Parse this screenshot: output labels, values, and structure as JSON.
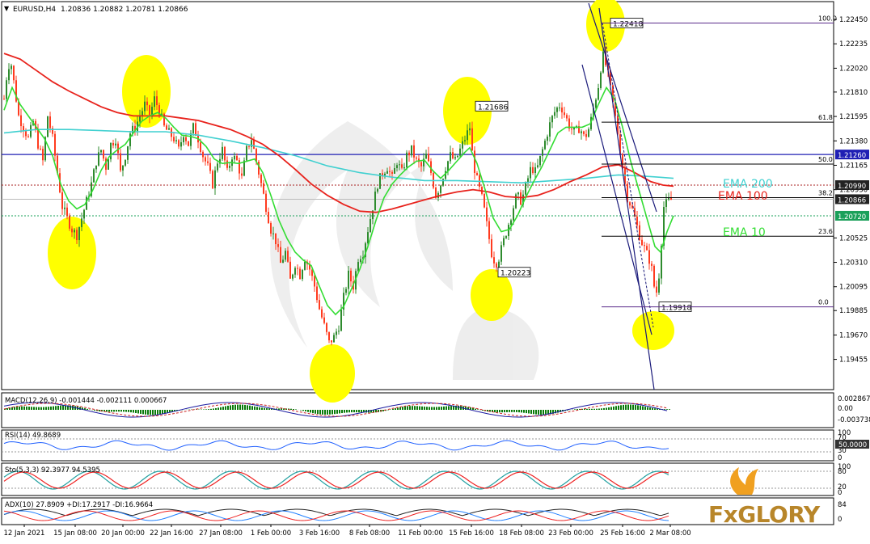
{
  "header": {
    "symbol_label": "EURUSD,H4",
    "ohlc_label": "1.20836 1.20882 1.20781 1.20866"
  },
  "indicator_labels": {
    "ema200": "EMA 200",
    "ema100": "EMA 100",
    "ema10": "EMA 10"
  },
  "colors": {
    "bull": "#2e8b2e",
    "bear": "#ff3b1f",
    "ema10": "#33dd33",
    "ema100": "#e8221c",
    "ema200": "#40d0d0",
    "highlight": "#ffff00",
    "hline_blue": "#1f1fb4",
    "trend": "#1a1a7a",
    "price_tag_bg": "#1f1fb4",
    "price_tag_green": "#1aa05a",
    "price_tag_red": "#cc1111"
  },
  "chart_data": [
    {
      "type": "candlestick",
      "title": "EURUSD,H4",
      "ylim": [
        1.19445,
        1.2245
      ],
      "y_ticks": [
        "1.22450",
        "1.22235",
        "1.22020",
        "1.21810",
        "1.21595",
        "1.21380",
        "1.21165",
        "1.20950",
        "1.20525",
        "1.20310",
        "1.20095",
        "1.19885",
        "1.19670",
        "1.19455"
      ],
      "x_labels": [
        "12 Jan 2021",
        "15 Jan 08:00",
        "20 Jan 00:00",
        "22 Jan 16:00",
        "27 Jan 08:00",
        "1 Feb 00:00",
        "3 Feb 16:00",
        "8 Feb 08:00",
        "11 Feb 00:00",
        "15 Feb 16:00",
        "18 Feb 08:00",
        "23 Feb 00:00",
        "25 Feb 16:00",
        "2 Mar 08:00"
      ],
      "close_path": [
        [
          0,
          1.2175
        ],
        [
          4,
          1.22
        ],
        [
          8,
          1.221
        ],
        [
          12,
          1.219
        ],
        [
          18,
          1.216
        ],
        [
          24,
          1.215
        ],
        [
          30,
          1.214
        ],
        [
          36,
          1.2155
        ],
        [
          42,
          1.2135
        ],
        [
          48,
          1.212
        ],
        [
          54,
          1.216
        ],
        [
          60,
          1.214
        ],
        [
          66,
          1.211
        ],
        [
          72,
          1.208
        ],
        [
          78,
          1.207
        ],
        [
          84,
          1.206
        ],
        [
          90,
          1.2055
        ],
        [
          96,
          1.207
        ],
        [
          102,
          1.2085
        ],
        [
          108,
          1.21
        ],
        [
          114,
          1.212
        ],
        [
          120,
          1.213
        ],
        [
          126,
          1.2115
        ],
        [
          132,
          1.2135
        ],
        [
          138,
          1.214
        ],
        [
          144,
          1.211
        ],
        [
          150,
          1.2125
        ],
        [
          156,
          1.2145
        ],
        [
          162,
          1.215
        ],
        [
          168,
          1.216
        ],
        [
          174,
          1.217
        ],
        [
          180,
          1.216
        ],
        [
          186,
          1.2175
        ],
        [
          192,
          1.2165
        ],
        [
          198,
          1.215
        ],
        [
          204,
          1.2145
        ],
        [
          210,
          1.214
        ],
        [
          216,
          1.213
        ],
        [
          222,
          1.2145
        ],
        [
          228,
          1.2135
        ],
        [
          234,
          1.215
        ],
        [
          240,
          1.214
        ],
        [
          246,
          1.2125
        ],
        [
          252,
          1.2115
        ],
        [
          258,
          1.21
        ],
        [
          264,
          1.212
        ],
        [
          270,
          1.213
        ],
        [
          276,
          1.211
        ],
        [
          282,
          1.2125
        ],
        [
          288,
          1.212
        ],
        [
          294,
          1.2105
        ],
        [
          300,
          1.213
        ],
        [
          306,
          1.214
        ],
        [
          312,
          1.212
        ],
        [
          318,
          1.21
        ],
        [
          324,
          1.208
        ],
        [
          330,
          1.206
        ],
        [
          336,
          1.205
        ],
        [
          342,
          1.203
        ],
        [
          348,
          1.204
        ],
        [
          354,
          1.2015
        ],
        [
          360,
          1.203
        ],
        [
          366,
          1.202
        ],
        [
          372,
          1.2035
        ],
        [
          378,
          1.2025
        ],
        [
          384,
          1.201
        ],
        [
          390,
          1.199
        ],
        [
          396,
          1.1975
        ],
        [
          402,
          1.196
        ],
        [
          408,
          1.1965
        ],
        [
          414,
          1.1975
        ],
        [
          420,
          1.2
        ],
        [
          426,
          1.202
        ],
        [
          432,
          1.201
        ],
        [
          438,
          1.2035
        ],
        [
          444,
          1.204
        ],
        [
          450,
          1.206
        ],
        [
          456,
          1.208
        ],
        [
          462,
          1.21
        ],
        [
          468,
          1.211
        ],
        [
          474,
          1.2115
        ],
        [
          480,
          1.2105
        ],
        [
          486,
          1.212
        ],
        [
          492,
          1.211
        ],
        [
          498,
          1.2125
        ],
        [
          504,
          1.213
        ],
        [
          510,
          1.212
        ],
        [
          516,
          1.2115
        ],
        [
          522,
          1.2125
        ],
        [
          528,
          1.211
        ],
        [
          534,
          1.209
        ],
        [
          540,
          1.21
        ],
        [
          546,
          1.2115
        ],
        [
          552,
          1.2125
        ],
        [
          558,
          1.212
        ],
        [
          564,
          1.213
        ],
        [
          570,
          1.214
        ],
        [
          576,
          1.215
        ],
        [
          580,
          1.212
        ],
        [
          586,
          1.21
        ],
        [
          592,
          1.2085
        ],
        [
          598,
          1.206
        ],
        [
          604,
          1.2035
        ],
        [
          610,
          1.203
        ],
        [
          616,
          1.2045
        ],
        [
          622,
          1.206
        ],
        [
          628,
          1.2075
        ],
        [
          634,
          1.209
        ],
        [
          640,
          1.2085
        ],
        [
          646,
          1.21
        ],
        [
          652,
          1.2115
        ],
        [
          658,
          1.211
        ],
        [
          664,
          1.2125
        ],
        [
          670,
          1.214
        ],
        [
          676,
          1.2155
        ],
        [
          682,
          1.2165
        ],
        [
          688,
          1.217
        ],
        [
          694,
          1.216
        ],
        [
          700,
          1.215
        ],
        [
          706,
          1.2145
        ],
        [
          712,
          1.215
        ],
        [
          718,
          1.214
        ],
        [
          724,
          1.215
        ],
        [
          730,
          1.217
        ],
        [
          736,
          1.219
        ],
        [
          740,
          1.2215
        ],
        [
          746,
          1.22
        ],
        [
          752,
          1.2175
        ],
        [
          758,
          1.215
        ],
        [
          764,
          1.212
        ],
        [
          770,
          1.209
        ],
        [
          776,
          1.208
        ],
        [
          782,
          1.2065
        ],
        [
          788,
          1.205
        ],
        [
          794,
          1.204
        ],
        [
          800,
          1.203
        ],
        [
          806,
          1.2
        ],
        [
          810,
          1.202
        ],
        [
          816,
          1.208
        ],
        [
          822,
          1.2085
        ],
        [
          828,
          1.2087
        ]
      ],
      "ema10_path": [
        [
          0,
          1.2165
        ],
        [
          10,
          1.2185
        ],
        [
          20,
          1.217
        ],
        [
          30,
          1.216
        ],
        [
          40,
          1.215
        ],
        [
          50,
          1.214
        ],
        [
          60,
          1.2125
        ],
        [
          70,
          1.21
        ],
        [
          80,
          1.2085
        ],
        [
          90,
          1.2078
        ],
        [
          100,
          1.2082
        ],
        [
          110,
          1.2095
        ],
        [
          120,
          1.2112
        ],
        [
          130,
          1.2124
        ],
        [
          140,
          1.213
        ],
        [
          150,
          1.2135
        ],
        [
          160,
          1.2145
        ],
        [
          170,
          1.2155
        ],
        [
          180,
          1.216
        ],
        [
          190,
          1.2163
        ],
        [
          200,
          1.2158
        ],
        [
          210,
          1.215
        ],
        [
          220,
          1.2143
        ],
        [
          230,
          1.2142
        ],
        [
          240,
          1.214
        ],
        [
          250,
          1.2133
        ],
        [
          260,
          1.2122
        ],
        [
          270,
          1.2118
        ],
        [
          280,
          1.2119
        ],
        [
          290,
          1.2118
        ],
        [
          300,
          1.212
        ],
        [
          310,
          1.2122
        ],
        [
          320,
          1.211
        ],
        [
          330,
          1.209
        ],
        [
          340,
          1.2068
        ],
        [
          350,
          1.2052
        ],
        [
          360,
          1.204
        ],
        [
          370,
          1.2033
        ],
        [
          380,
          1.2028
        ],
        [
          390,
          1.201
        ],
        [
          400,
          1.1993
        ],
        [
          410,
          1.1985
        ],
        [
          420,
          1.1992
        ],
        [
          430,
          1.2008
        ],
        [
          440,
          1.2025
        ],
        [
          450,
          1.2045
        ],
        [
          460,
          1.2068
        ],
        [
          470,
          1.2088
        ],
        [
          480,
          1.21
        ],
        [
          490,
          1.2108
        ],
        [
          500,
          1.2115
        ],
        [
          510,
          1.212
        ],
        [
          520,
          1.2121
        ],
        [
          530,
          1.2112
        ],
        [
          540,
          1.2105
        ],
        [
          550,
          1.2112
        ],
        [
          560,
          1.212
        ],
        [
          570,
          1.2128
        ],
        [
          576,
          1.2132
        ],
        [
          585,
          1.2118
        ],
        [
          595,
          1.2095
        ],
        [
          605,
          1.207
        ],
        [
          615,
          1.2058
        ],
        [
          625,
          1.206
        ],
        [
          635,
          1.2072
        ],
        [
          645,
          1.2088
        ],
        [
          655,
          1.2102
        ],
        [
          665,
          1.2115
        ],
        [
          675,
          1.213
        ],
        [
          685,
          1.2145
        ],
        [
          695,
          1.215
        ],
        [
          705,
          1.215
        ],
        [
          715,
          1.215
        ],
        [
          725,
          1.2153
        ],
        [
          735,
          1.217
        ],
        [
          745,
          1.2185
        ],
        [
          755,
          1.2175
        ],
        [
          765,
          1.215
        ],
        [
          775,
          1.212
        ],
        [
          785,
          1.2095
        ],
        [
          795,
          1.207
        ],
        [
          805,
          1.2045
        ],
        [
          812,
          1.204
        ],
        [
          820,
          1.2058
        ],
        [
          828,
          1.2072
        ]
      ],
      "ema100_path": [
        [
          0,
          1.2215
        ],
        [
          20,
          1.221
        ],
        [
          40,
          1.22
        ],
        [
          60,
          1.219
        ],
        [
          80,
          1.2182
        ],
        [
          100,
          1.2175
        ],
        [
          120,
          1.2168
        ],
        [
          140,
          1.2163
        ],
        [
          160,
          1.216
        ],
        [
          180,
          1.216
        ],
        [
          200,
          1.216
        ],
        [
          220,
          1.2158
        ],
        [
          240,
          1.2156
        ],
        [
          260,
          1.2152
        ],
        [
          280,
          1.2148
        ],
        [
          300,
          1.2142
        ],
        [
          320,
          1.2135
        ],
        [
          340,
          1.2125
        ],
        [
          360,
          1.2113
        ],
        [
          380,
          1.21
        ],
        [
          400,
          1.209
        ],
        [
          420,
          1.2082
        ],
        [
          440,
          1.2076
        ],
        [
          460,
          1.2075
        ],
        [
          480,
          1.2078
        ],
        [
          500,
          1.2082
        ],
        [
          520,
          1.2086
        ],
        [
          540,
          1.209
        ],
        [
          560,
          1.2093
        ],
        [
          580,
          1.2095
        ],
        [
          600,
          1.2093
        ],
        [
          620,
          1.2089
        ],
        [
          640,
          1.2088
        ],
        [
          660,
          1.209
        ],
        [
          680,
          1.2095
        ],
        [
          700,
          1.2102
        ],
        [
          720,
          1.2108
        ],
        [
          740,
          1.2115
        ],
        [
          760,
          1.2117
        ],
        [
          780,
          1.211
        ],
        [
          800,
          1.2102
        ],
        [
          815,
          1.2099
        ],
        [
          828,
          1.2098
        ]
      ],
      "ema200_path": [
        [
          0,
          1.2145
        ],
        [
          40,
          1.2148
        ],
        [
          80,
          1.2148
        ],
        [
          120,
          1.2147
        ],
        [
          160,
          1.2146
        ],
        [
          200,
          1.2146
        ],
        [
          240,
          1.2143
        ],
        [
          280,
          1.2138
        ],
        [
          320,
          1.2132
        ],
        [
          360,
          1.2125
        ],
        [
          400,
          1.2116
        ],
        [
          440,
          1.211
        ],
        [
          480,
          1.2106
        ],
        [
          520,
          1.2103
        ],
        [
          560,
          1.2103
        ],
        [
          600,
          1.2102
        ],
        [
          640,
          1.2101
        ],
        [
          680,
          1.2103
        ],
        [
          720,
          1.2105
        ],
        [
          760,
          1.2108
        ],
        [
          790,
          1.2107
        ],
        [
          810,
          1.2106
        ],
        [
          828,
          1.2105
        ]
      ],
      "horizontal_lines": [
        {
          "label": "1.22418",
          "price": 1.22418,
          "style": "solid"
        },
        {
          "label": "1.21260",
          "price": 1.2126,
          "style": "solid"
        },
        {
          "label": "1.20990",
          "price": 1.2099,
          "style": "dotted"
        },
        {
          "label": "1.20720",
          "price": 1.2072,
          "style": "dotted"
        },
        {
          "label": "1.20866",
          "price": 1.20866,
          "style": "solid"
        }
      ],
      "fibonacci": [
        {
          "label": "100.0",
          "price": 1.22418
        },
        {
          "label": "61.8",
          "price": 1.21545
        },
        {
          "label": "50.0",
          "price": 1.21175
        },
        {
          "label": "38.2",
          "price": 1.2088
        },
        {
          "label": "23.6",
          "price": 1.2054
        },
        {
          "label": "0.0",
          "price": 1.19918
        }
      ],
      "annotations": [
        {
          "label": "1.22418",
          "price": 1.22418
        },
        {
          "label": "1.21686",
          "price": 1.21686
        },
        {
          "label": "1.20223",
          "price": 1.20223
        },
        {
          "label": "1.19918",
          "price": 1.19918
        }
      ],
      "price_tags": [
        {
          "label": "1.21260",
          "price": 1.2126,
          "kind": "blue"
        },
        {
          "label": "1.20990",
          "price": 1.2099,
          "kind": "dark"
        },
        {
          "label": "1.20866",
          "price": 1.20866,
          "kind": "dark"
        },
        {
          "label": "1.20720",
          "price": 1.2072,
          "kind": "green"
        }
      ]
    },
    {
      "type": "histogram",
      "title": "MACD(12,26,9) -0.001444 -0.002111 0.000667",
      "y_ticks": [
        "0.002867",
        "0.00",
        "-0.003738"
      ]
    },
    {
      "type": "line",
      "title": "RSI(14) 49.8689",
      "y_ticks": [
        "100",
        "70",
        "30",
        "0"
      ],
      "current_label": "50.0000"
    },
    {
      "type": "line",
      "title": "Sto(5,3,3) 92.3977 94.5395",
      "y_ticks": [
        "100",
        "80",
        "20",
        "0"
      ]
    },
    {
      "type": "line",
      "title": "ADX(10) 27.8909 +DI:17.2917 -DI:16.9664",
      "y_ticks": [
        "84",
        "0"
      ]
    }
  ],
  "watermark": {
    "brand": "FxGLORY"
  }
}
